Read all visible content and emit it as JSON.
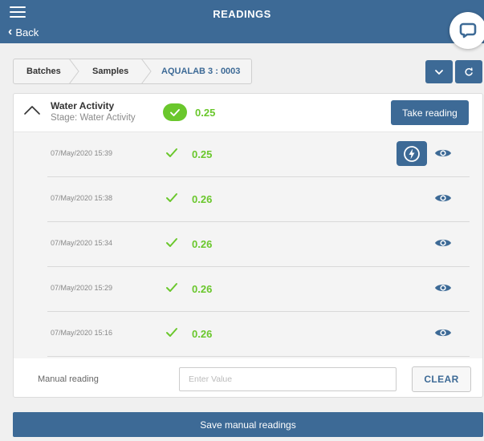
{
  "header": {
    "title": "READINGS",
    "back_label": "Back"
  },
  "breadcrumb": {
    "items": [
      "Batches",
      "Samples",
      "AQUALAB 3 : 0003"
    ]
  },
  "section": {
    "title": "Water Activity",
    "stage": "Stage: Water Activity",
    "current_value": "0.25",
    "take_reading_label": "Take reading"
  },
  "readings": [
    {
      "date": "07/May/2020 15:39",
      "value": "0.25"
    },
    {
      "date": "07/May/2020 15:38",
      "value": "0.26"
    },
    {
      "date": "07/May/2020 15:34",
      "value": "0.26"
    },
    {
      "date": "07/May/2020 15:29",
      "value": "0.26"
    },
    {
      "date": "07/May/2020 15:16",
      "value": "0.26"
    }
  ],
  "manual": {
    "label": "Manual reading",
    "placeholder": "Enter Value",
    "clear_label": "CLEAR"
  },
  "save_label": "Save manual readings",
  "colors": {
    "primary": "#3d6a96",
    "success": "#6ac72c"
  },
  "icons": [
    "menu-icon",
    "chevron-left-icon",
    "chat-icon",
    "chevron-down-icon",
    "refresh-icon",
    "chevron-up-icon",
    "check-icon",
    "flash-icon",
    "eye-icon"
  ]
}
